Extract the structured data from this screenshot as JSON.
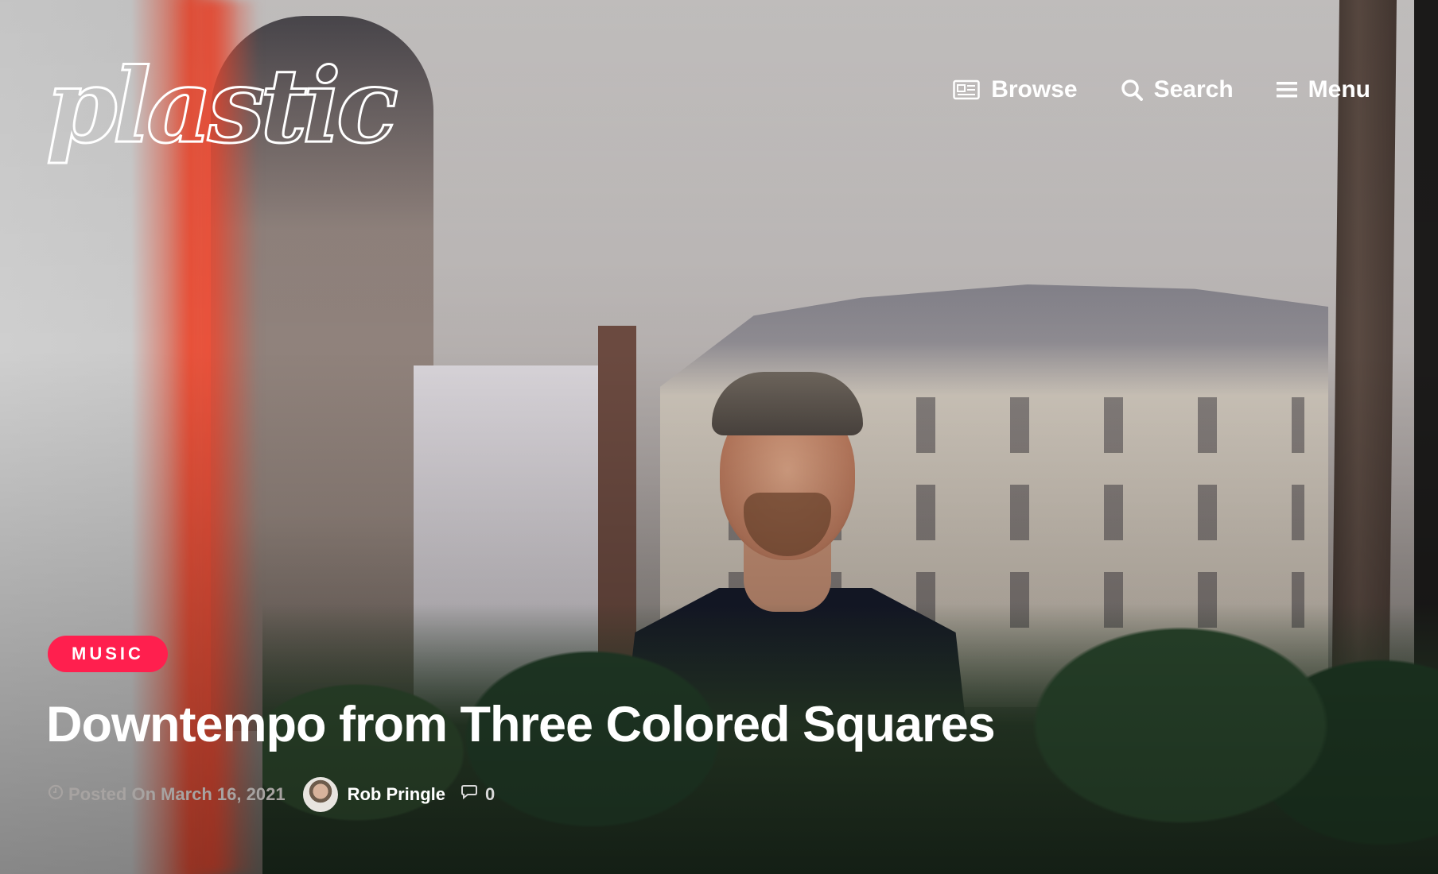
{
  "header": {
    "logo_text": "plastic",
    "nav": {
      "browse_label": "Browse",
      "search_label": "Search",
      "menu_label": "Menu"
    }
  },
  "article": {
    "category": "MUSIC",
    "title": "Downtempo from Three Colored Squares",
    "posted_prefix": "Posted On",
    "date": "March 16, 2021",
    "author": "Rob Pringle",
    "comment_count": "0"
  },
  "icons": {
    "browse": "newspaper-icon",
    "search": "search-icon",
    "menu": "hamburger-menu-icon",
    "posted": "clock-icon",
    "comments": "comment-bubble-icon"
  },
  "colors": {
    "accent": "#ff1f4e",
    "text": "#ffffff",
    "meta_muted": "#a7a3a1"
  }
}
